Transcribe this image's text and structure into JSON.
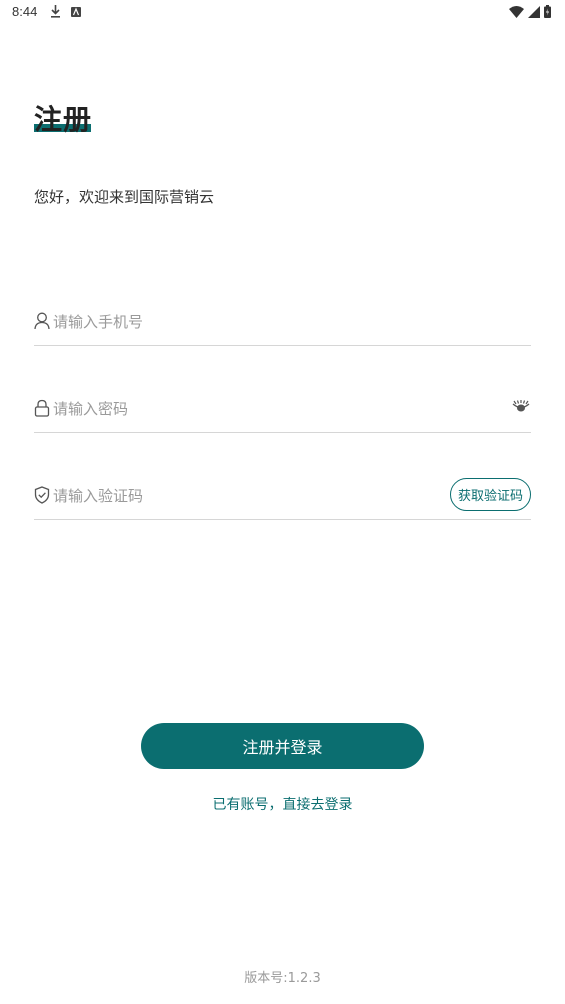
{
  "status_bar": {
    "time": "8:44",
    "left_icons": [
      "download-icon",
      "app-notification-icon"
    ],
    "right_icons": [
      "wifi-icon",
      "signal-icon",
      "battery-icon"
    ]
  },
  "header": {
    "title": "注册",
    "subtitle": "您好，欢迎来到国际营销云"
  },
  "form": {
    "phone": {
      "placeholder": "请输入手机号",
      "value": "",
      "icon": "user-icon"
    },
    "password": {
      "placeholder": "请输入密码",
      "value": "",
      "icon": "lock-icon",
      "toggle_icon": "eye-closed-icon"
    },
    "code": {
      "placeholder": "请输入验证码",
      "value": "",
      "icon": "shield-check-icon",
      "get_code_label": "获取验证码"
    }
  },
  "actions": {
    "submit_label": "注册并登录",
    "login_link": "已有账号，直接去登录"
  },
  "footer": {
    "version": "版本号:1.2.3"
  },
  "colors": {
    "accent": "#0b6e70",
    "placeholder": "#9a9a9a",
    "divider": "#d6d6d6"
  }
}
